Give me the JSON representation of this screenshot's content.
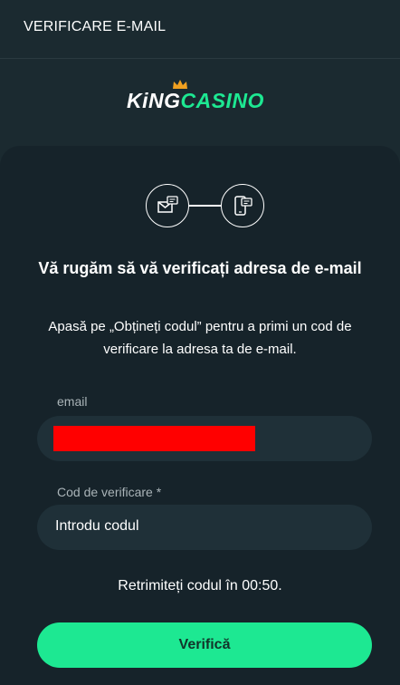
{
  "header": {
    "title": "VERIFICARE E-MAIL"
  },
  "logo": {
    "part1": "KiNG",
    "part2": "CASINO"
  },
  "steps": {
    "icons": [
      "mail-icon",
      "phone-chat-icon"
    ]
  },
  "content": {
    "title": "Vă rugăm să vă verificați adresa de e-mail",
    "subtitle": "Apasă pe „Obțineți codul” pentru a primi un cod de verificare la adresa ta de e-mail."
  },
  "email_field": {
    "label": "email",
    "value_redacted": true
  },
  "code_field": {
    "label": "Cod de verificare *",
    "value": "Introdu codul"
  },
  "resend": {
    "text": "Retrimiteți codul în 00:50."
  },
  "verify_button": {
    "label": "Verifică"
  },
  "colors": {
    "accent": "#1de892",
    "background": "#1b2a30",
    "card": "#16232a",
    "input": "#1f3038",
    "redaction": "#ff0000"
  }
}
